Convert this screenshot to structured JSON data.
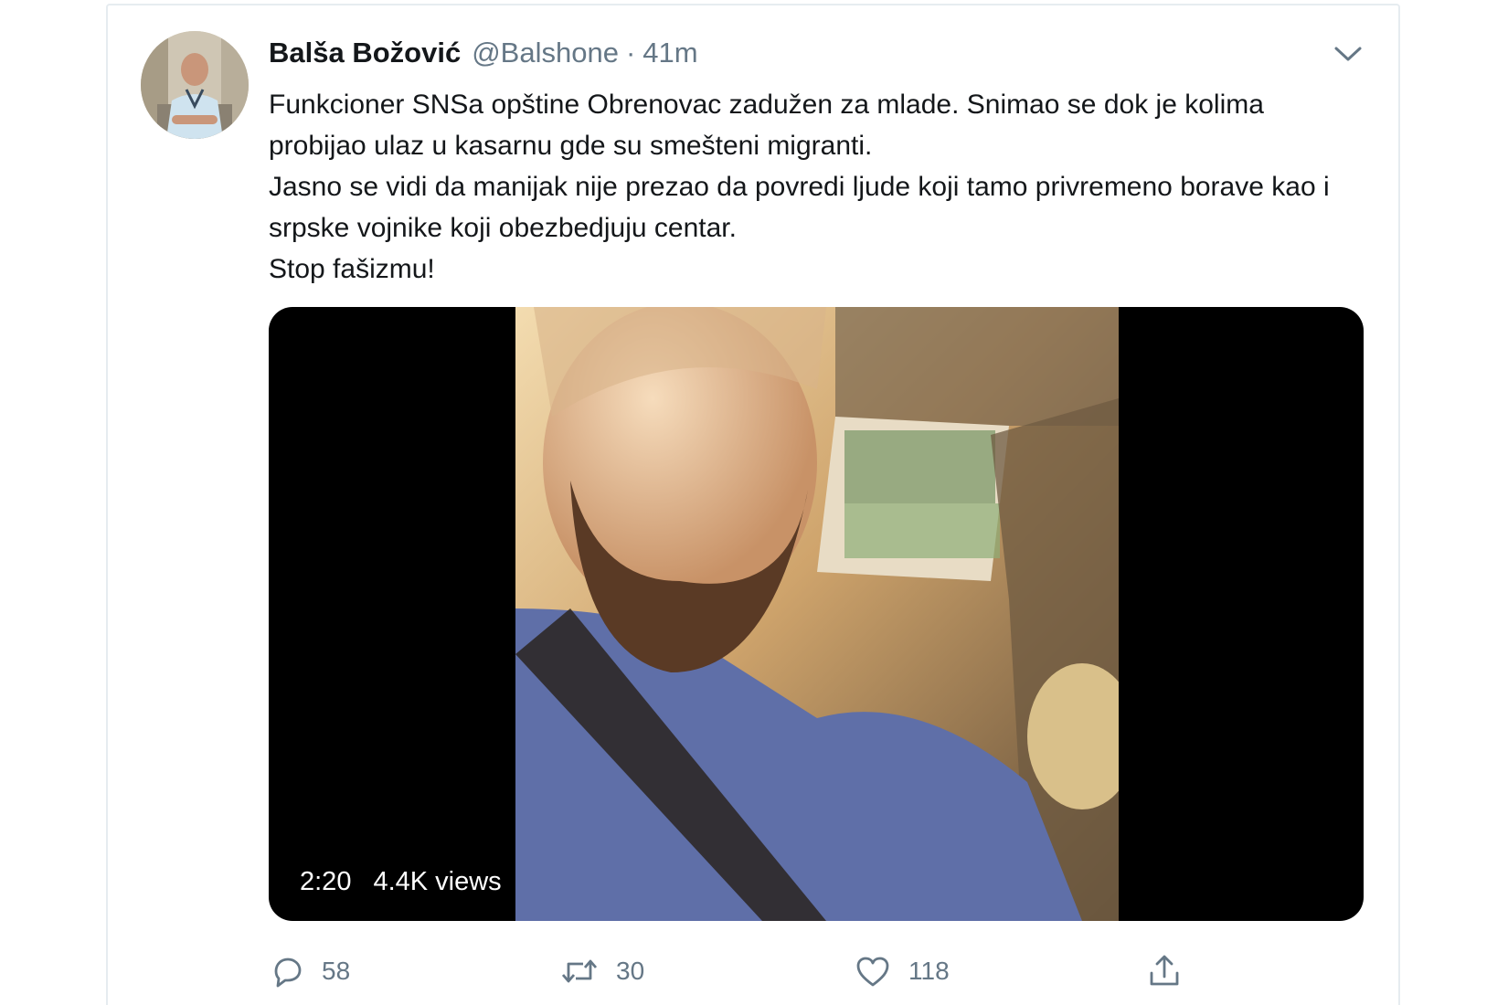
{
  "tweet": {
    "author_name": "Balša Božović",
    "handle": "@Balshone",
    "separator": "·",
    "time": "41m",
    "text_lines": [
      "Funkcioner SNSa opštine Obrenovac zadužen za mlade. Snimao se dok je kolima probijao ulaz u kasarnu gde su smešteni migranti.",
      "Jasno se vidi da manijak nije prezao da povredi ljude koji tamo privremeno borave kao i srpske vojnike koji obezbedjuju centar.",
      "Stop fašizmu!"
    ],
    "video": {
      "duration": "2:20",
      "views": "4.4K views"
    },
    "actions": {
      "reply_count": "58",
      "retweet_count": "30",
      "like_count": "118"
    }
  },
  "colors": {
    "secondary_text": "#657786",
    "primary_text": "#14171a",
    "border": "#e6ecf0"
  },
  "icons": [
    "chevron-down-icon",
    "reply-icon",
    "retweet-icon",
    "like-icon",
    "share-icon"
  ]
}
